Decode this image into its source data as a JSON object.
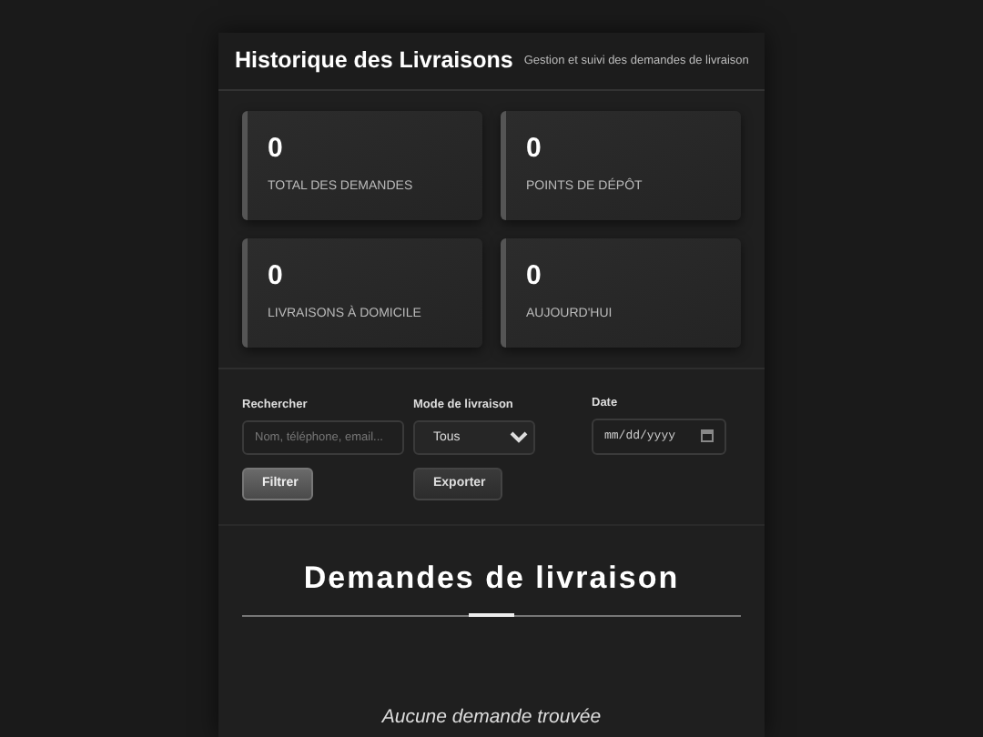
{
  "header": {
    "title": "Historique des Livraisons",
    "subtitle": "Gestion et suivi des demandes de livraison"
  },
  "stats": [
    {
      "value": "0",
      "label": "TOTAL DES DEMANDES"
    },
    {
      "value": "0",
      "label": "POINTS DE DÉPÔT"
    },
    {
      "value": "0",
      "label": "LIVRAISONS À DOMICILE"
    },
    {
      "value": "0",
      "label": "AUJOURD'HUI"
    }
  ],
  "filters": {
    "search": {
      "label": "Rechercher",
      "placeholder": "Nom, téléphone, email..."
    },
    "mode": {
      "label": "Mode de livraison",
      "value": "Tous"
    },
    "date": {
      "label": "Date",
      "placeholder": "mm/dd/yyyy"
    }
  },
  "buttons": [
    {
      "label": "Filtrer",
      "kind": "primary"
    },
    {
      "label": "Exporter",
      "kind": "secondary"
    }
  ],
  "section": {
    "title": "Demandes de livraison",
    "empty_message": "Aucune demande trouvée"
  }
}
